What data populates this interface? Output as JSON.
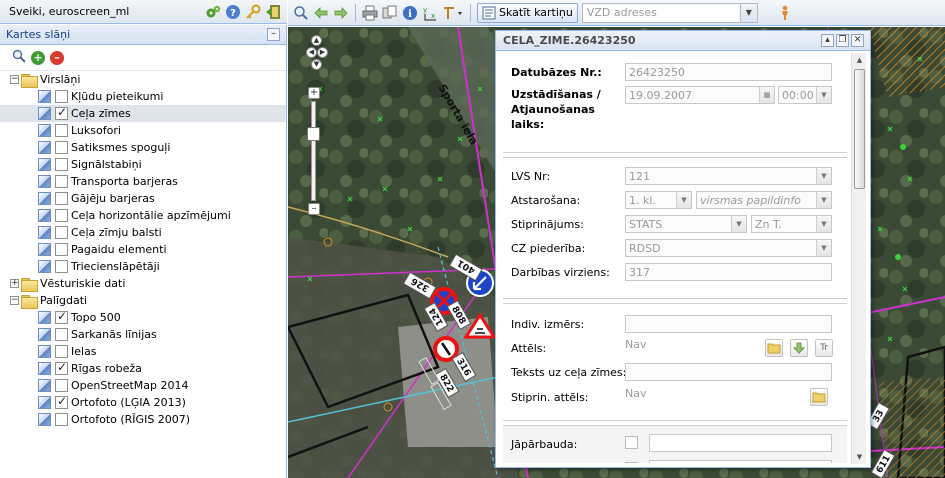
{
  "topbar": {
    "greeting_prefix": "Sveiki, ",
    "username": "euroscreen_ml"
  },
  "toolbar": {
    "view_map_label": "Skatīt kartiņu",
    "address_placeholder": "VZD adreses"
  },
  "layer_panel": {
    "title": "Kartes slāņi",
    "groups": [
      {
        "label": "Virslāņi",
        "expanded": true,
        "items": [
          {
            "label": "Kļūdu pieteikumi",
            "checked": false,
            "selected": false
          },
          {
            "label": "Ceļa zīmes",
            "checked": true,
            "selected": true
          },
          {
            "label": "Luksofori",
            "checked": false,
            "selected": false
          },
          {
            "label": "Satiksmes spoguļi",
            "checked": false,
            "selected": false
          },
          {
            "label": "Signālstabiņi",
            "checked": false,
            "selected": false
          },
          {
            "label": "Transporta barjeras",
            "checked": false,
            "selected": false
          },
          {
            "label": "Gājēju barjeras",
            "checked": false,
            "selected": false
          },
          {
            "label": "Ceļa horizontālie apzīmējumi",
            "checked": false,
            "selected": false
          },
          {
            "label": "Ceļa zīmju balsti",
            "checked": false,
            "selected": false
          },
          {
            "label": "Pagaidu elementi",
            "checked": false,
            "selected": false
          },
          {
            "label": "Triecienslāpētāji",
            "checked": false,
            "selected": false
          }
        ]
      },
      {
        "label": "Vēsturiskie dati",
        "expanded": false,
        "items": []
      },
      {
        "label": "Palīgdati",
        "expanded": true,
        "items": [
          {
            "label": "Topo 500",
            "checked": true,
            "selected": false
          },
          {
            "label": "Sarkanās līnijas",
            "checked": false,
            "selected": false
          },
          {
            "label": "Ielas",
            "checked": false,
            "selected": false
          },
          {
            "label": "Rīgas robeža",
            "checked": true,
            "selected": false
          },
          {
            "label": "OpenStreetMap 2014",
            "checked": false,
            "selected": false
          },
          {
            "label": "Ortofoto (LĢIA 2013)",
            "checked": true,
            "selected": false
          },
          {
            "label": "Ortofoto (RĪGIS 2007)",
            "checked": false,
            "selected": false
          }
        ]
      }
    ]
  },
  "map": {
    "street_label": "Sporta iela",
    "sign_labels": [
      "326",
      "401",
      "124",
      "808",
      "316",
      "822",
      "33",
      "611"
    ]
  },
  "feature_window": {
    "title": "CELA_ZIME.26423250",
    "db_number_label": "Datubāzes Nr.:",
    "db_number_value": "26423250",
    "install_time_label_1": "Uzstādīšanas /",
    "install_time_label_2": "Atjaunošanas",
    "install_time_label_3": "laiks:",
    "install_date": "19.09.2007",
    "install_time": "00:00",
    "lvs_label": "LVS Nr:",
    "lvs_value": "121",
    "reflection_label": "Atstarošana:",
    "reflection_value": "1. kl.",
    "reflection_extra_placeholder": "virsmas papildinfo",
    "mount_label": "Stiprinājums:",
    "mount_value": "STATS",
    "mount_extra": "Zn T.",
    "owner_label": "CZ piederība:",
    "owner_value": "RDSD",
    "direction_label": "Darbības virziens:",
    "direction_value": "317",
    "indiv_size_label": "Indiv. izmērs:",
    "image_label": "Attēls:",
    "image_value": "Nav",
    "sign_text_label": "Teksts uz ceļa zīmes:",
    "mount_image_label": "Stiprin. attēls:",
    "mount_image_value": "Nav",
    "check_label": "Jāpārbauda:",
    "tr_button_label": "Tr"
  }
}
